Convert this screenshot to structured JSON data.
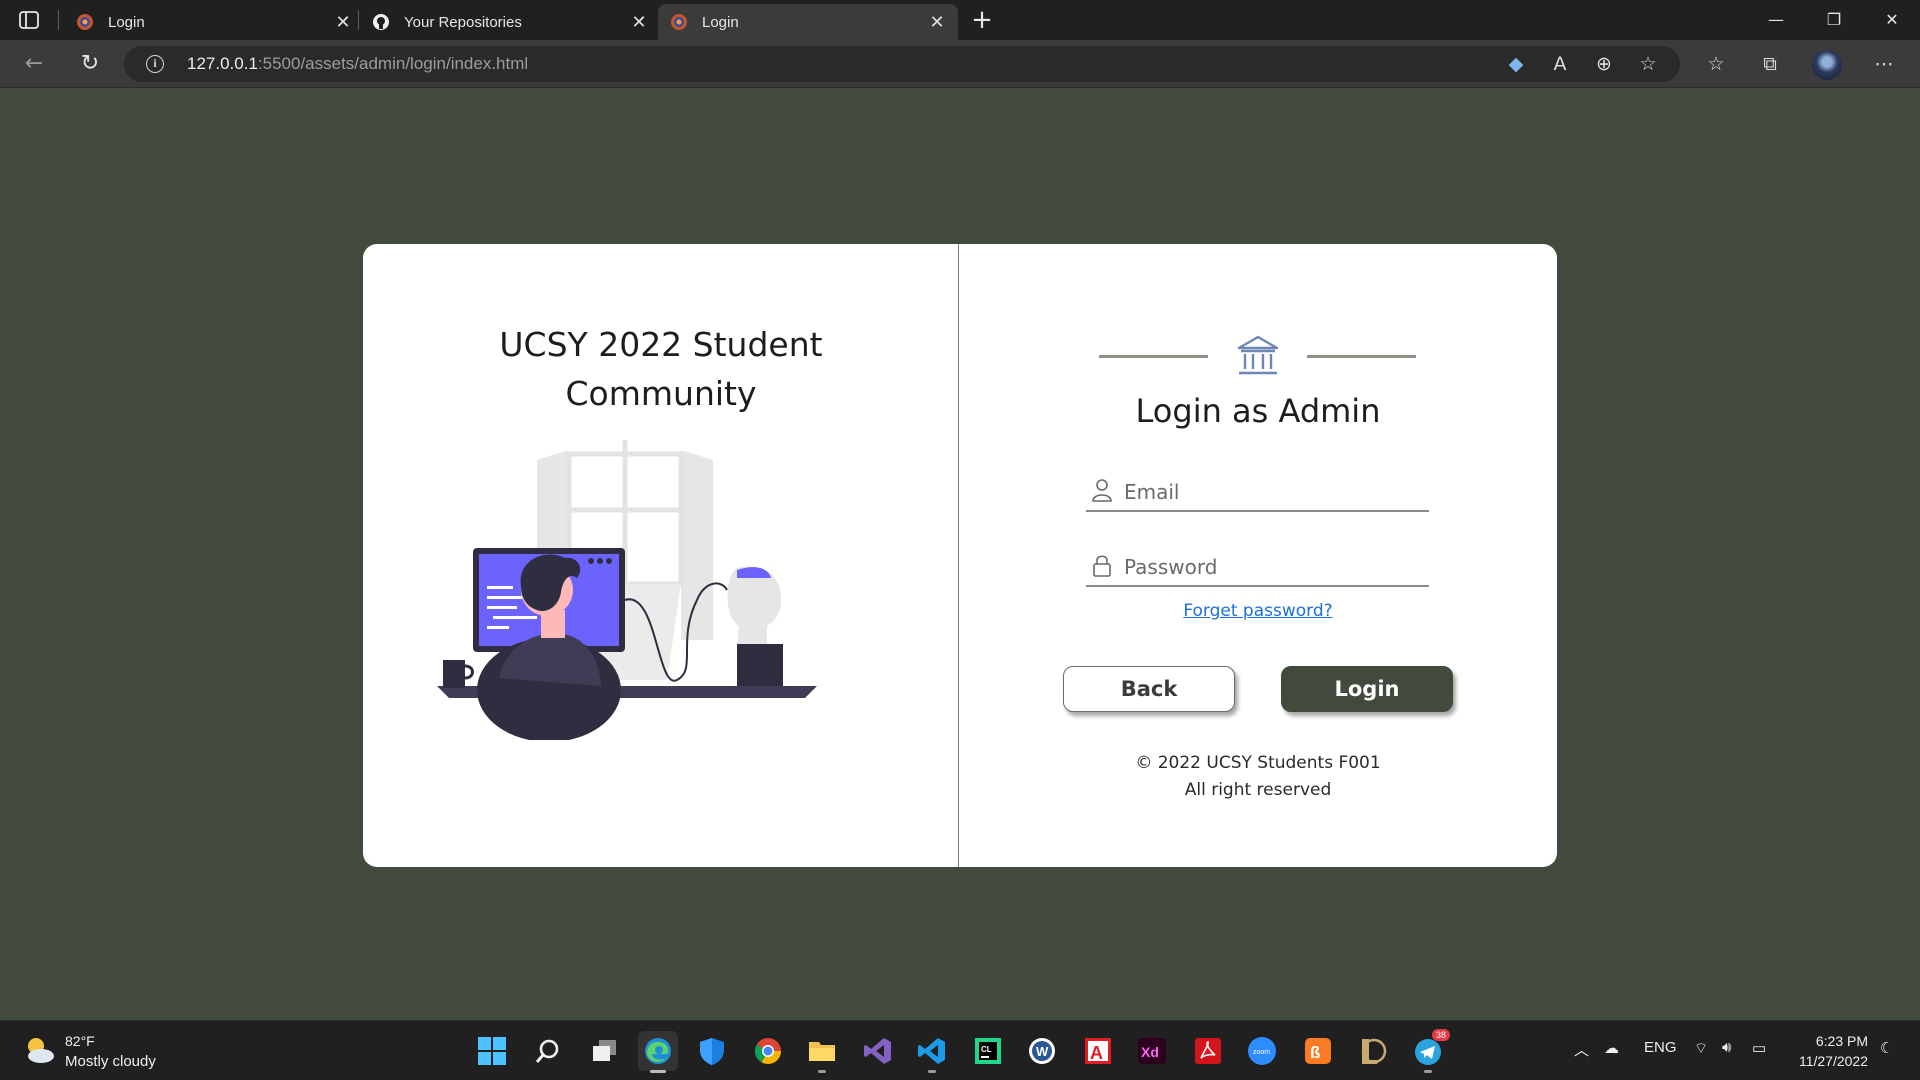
{
  "browser": {
    "tabs": [
      {
        "title": "Login",
        "icon": "firefox-dev-icon",
        "active": false
      },
      {
        "title": "Your Repositories",
        "icon": "github-icon",
        "active": false
      },
      {
        "title": "Login",
        "icon": "firefox-dev-icon",
        "active": true
      }
    ],
    "url": {
      "host": "127.0.0.1",
      "path": ":5500/assets/admin/login/index.html"
    }
  },
  "page": {
    "left_title_line1": "UCSY 2022 Student",
    "left_title_line2": "Community",
    "heading": "Login as Admin",
    "email_placeholder": "Email",
    "password_placeholder": "Password",
    "forget_link": "Forget password?",
    "back_label": "Back",
    "login_label": "Login",
    "copyright_line1": "© 2022 UCSY Students F001",
    "copyright_line2": "All right reserved",
    "colors": {
      "background": "#414a3c",
      "accent": "#414a3c",
      "link": "#1a6fdc"
    }
  },
  "taskbar": {
    "weather": {
      "temp": "82°F",
      "desc": "Mostly cloudy"
    },
    "language": "ENG",
    "time": "6:23 PM",
    "date": "11/27/2022",
    "telegram_badge": "38",
    "apps": [
      "start",
      "search",
      "task-view",
      "edge",
      "defender",
      "chrome",
      "file-explorer",
      "visual-studio",
      "vscode",
      "clion",
      "word-app",
      "autocad",
      "adobe-xd",
      "acrobat",
      "zoom",
      "xampp",
      "league",
      "telegram"
    ]
  }
}
